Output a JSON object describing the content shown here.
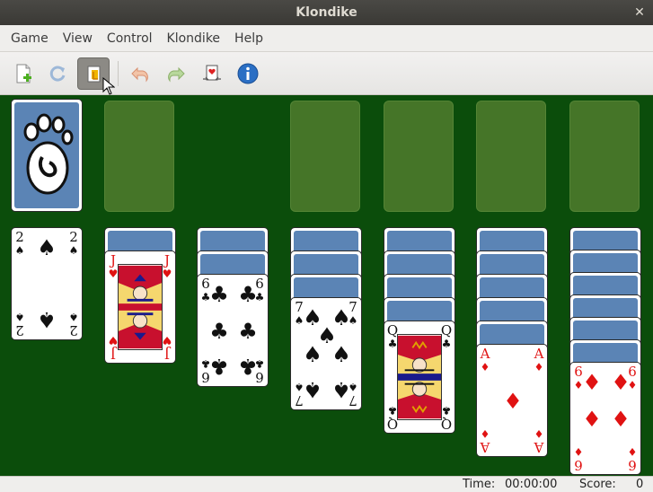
{
  "window": {
    "title": "Klondike",
    "close_glyph": "✕"
  },
  "menu": [
    "Game",
    "View",
    "Control",
    "Klondike",
    "Help"
  ],
  "toolbar": {
    "buttons": [
      {
        "name": "new-game-icon"
      },
      {
        "name": "restart-icon"
      },
      {
        "name": "select-game-icon",
        "active": true
      },
      {
        "name": "undo-icon"
      },
      {
        "name": "redo-icon"
      },
      {
        "name": "deal-icon"
      },
      {
        "name": "info-icon"
      }
    ]
  },
  "colors": {
    "felt": "#0b4d0b",
    "slot": "#4c7a2c",
    "card_back": "#5b84b5",
    "red": "#e01212"
  },
  "cards": {
    "col1": {
      "rank": "2",
      "suit": "♠",
      "color": "black"
    },
    "col2": {
      "rank": "J",
      "suit": "♥",
      "color": "red"
    },
    "col3": {
      "rank": "6",
      "suit": "♣",
      "color": "black"
    },
    "col4": {
      "rank": "7",
      "suit": "♠",
      "color": "black"
    },
    "col5": {
      "rank": "Q",
      "suit": "♣",
      "color": "black"
    },
    "col6": {
      "rank": "A",
      "suit": "♦",
      "color": "red"
    },
    "col7": {
      "rank": "6",
      "suit": "♦",
      "color": "red"
    }
  },
  "status": {
    "time_label": "Time:",
    "time_value": "00:00:00",
    "score_label": "Score:",
    "score_value": "0"
  }
}
